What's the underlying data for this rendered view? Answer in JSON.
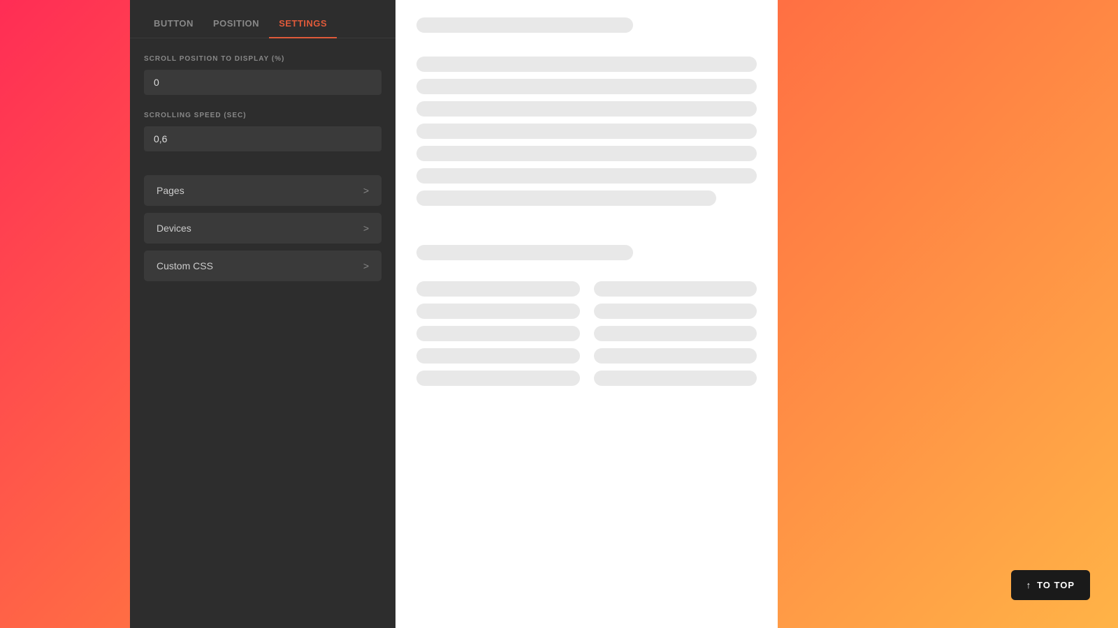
{
  "tabs": [
    {
      "id": "button",
      "label": "BUTTON",
      "active": false
    },
    {
      "id": "position",
      "label": "POSITION",
      "active": false
    },
    {
      "id": "settings",
      "label": "SETTINGS",
      "active": true
    }
  ],
  "settings": {
    "scroll_position_label": "SCROLL POSITION TO DISPLAY (%)",
    "scroll_position_value": "0",
    "scrolling_speed_label": "SCROLLING SPEED (SEC)",
    "scrolling_speed_value": "0,6"
  },
  "expandable_rows": [
    {
      "id": "pages",
      "label": "Pages"
    },
    {
      "id": "devices",
      "label": "Devices"
    },
    {
      "id": "custom-css",
      "label": "Custom CSS"
    }
  ],
  "to_top_button": {
    "label": "TO TOP",
    "icon": "↑"
  }
}
